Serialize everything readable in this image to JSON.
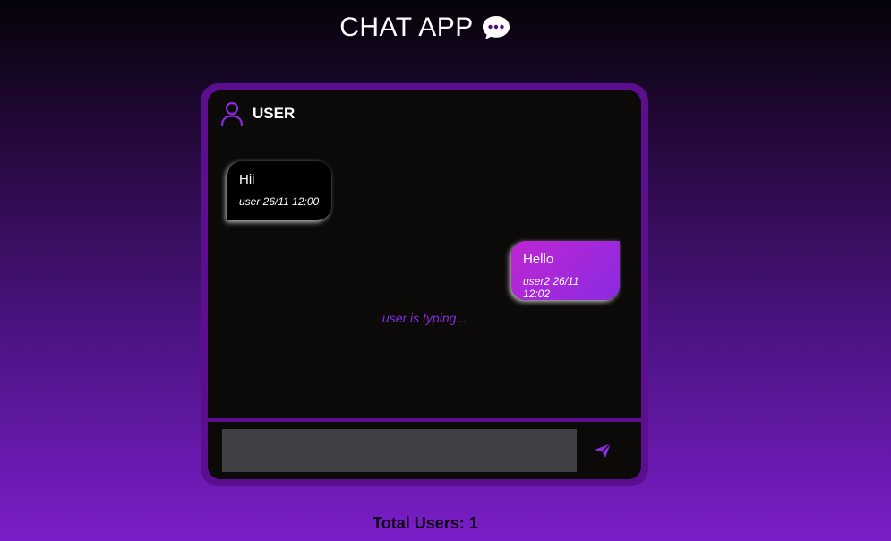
{
  "app": {
    "title": "CHAT APP",
    "title_icon": "chat-bubble-icon"
  },
  "chat": {
    "header": {
      "name": "USER",
      "icon": "user-icon"
    },
    "messages": [
      {
        "direction": "incoming",
        "text": "Hii",
        "meta": "user 26/11 12:00"
      },
      {
        "direction": "outgoing",
        "text": "Hello",
        "meta": "user2 26/11 12:02"
      }
    ],
    "typing_indicator": "user is typing...",
    "input": {
      "value": "",
      "placeholder": ""
    },
    "send_icon": "send-icon"
  },
  "footer": {
    "total_users": "Total Users: 1"
  },
  "colors": {
    "accent": "#8a2be2",
    "frame": "#5b0f8f",
    "panel": "#0b0a09",
    "outgoing_gradient_start": "#c026d3",
    "outgoing_gradient_end": "#8a2be2",
    "input_bg": "#3f3f46"
  }
}
